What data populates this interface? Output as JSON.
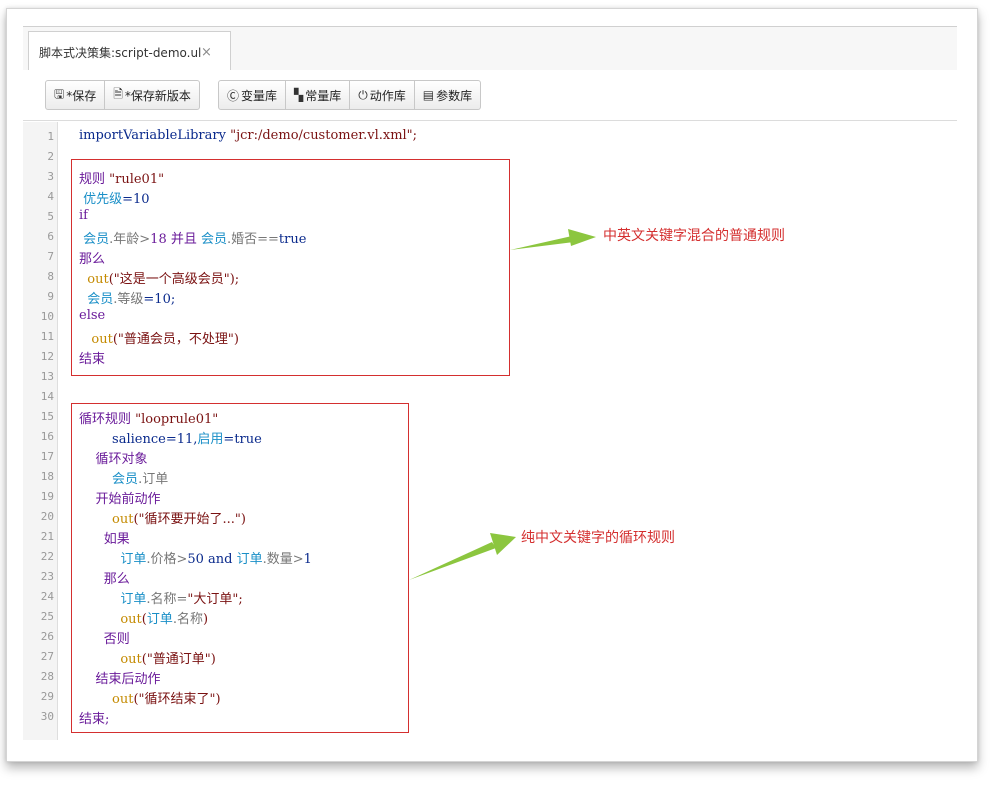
{
  "tab": {
    "title": "脚本式决策集:script-demo.ul",
    "close": "×"
  },
  "toolbar": {
    "group1": [
      {
        "icon": "🖫",
        "label": "*保存"
      },
      {
        "icon": "🗎",
        "label": "*保存新版本"
      }
    ],
    "group2": [
      {
        "icon": "Ⓒ",
        "label": "变量库"
      },
      {
        "icon": "▚",
        "label": "常量库"
      },
      {
        "icon": "⏻",
        "label": "动作库"
      },
      {
        "icon": "▤",
        "label": "参数库"
      }
    ]
  },
  "line_numbers": [
    "1",
    "2",
    "3",
    "4",
    "5",
    "6",
    "7",
    "8",
    "9",
    "10",
    "11",
    "12",
    "13",
    "14",
    "15",
    "16",
    "17",
    "18",
    "19",
    "20",
    "21",
    "22",
    "23",
    "24",
    "25",
    "26",
    "27",
    "28",
    "29",
    "30"
  ],
  "code": {
    "l1_a": "importVariableLibrary ",
    "l1_b": "\"jcr:/demo/customer.vl.xml\";",
    "l3_a": "规则 ",
    "l3_b": "\"rule01\"",
    "l4_a": " 优先级",
    "l4_b": "=10",
    "l5_a": "if",
    "l6_a": " 会员",
    "l6_b": ".年龄>",
    "l6_c": "18 并且 ",
    "l6_d": "会员",
    "l6_e": ".婚否==",
    "l6_f": "true",
    "l7_a": "那么",
    "l8_a": "  out",
    "l8_b": "(\"这是一个高级会员\");",
    "l9_a": "  会员",
    "l9_b": ".等级",
    "l9_c": "=10;",
    "l10_a": "else",
    "l11_a": "   out",
    "l11_b": "(\"普通会员，不处理\")",
    "l12_a": "结束",
    "l15_a": "循环规则 ",
    "l15_b": "\"looprule01\"",
    "l16_a": "        salience=11,",
    "l16_b": "启用",
    "l16_c": "=true",
    "l17_a": "    循环对象",
    "l18_a": "        会员",
    "l18_b": ".订单",
    "l19_a": "    开始前动作",
    "l20_a": "        out",
    "l20_b": "(\"循环要开始了...\")",
    "l21_a": "      如果",
    "l22_a": "          订单",
    "l22_b": ".价格>",
    "l22_c": "50 and ",
    "l22_d": "订单",
    "l22_e": ".数量>",
    "l22_f": "1",
    "l23_a": "      那么",
    "l24_a": "          订单",
    "l24_b": ".名称=",
    "l24_c": "\"大订单\";",
    "l25_a": "          out",
    "l25_b": "(",
    "l25_c": "订单",
    "l25_d": ".名称",
    "l25_e": ")",
    "l26_a": "      否则",
    "l27_a": "          out",
    "l27_b": "(\"普通订单\")",
    "l28_a": "    结束后动作",
    "l29_a": "        out",
    "l29_b": "(\"循环结束了\")",
    "l30_a": "结束;"
  },
  "callouts": {
    "first": "中英文关键字混合的普通规则",
    "second": "纯中文关键字的循环规则"
  },
  "colors": {
    "annotation": "#d42f2f",
    "arrow": "#8cc63f",
    "keyword": "#6a1b9a",
    "variable": "#1a8fc7",
    "string": "#7a1212",
    "function": "#c48a00"
  }
}
